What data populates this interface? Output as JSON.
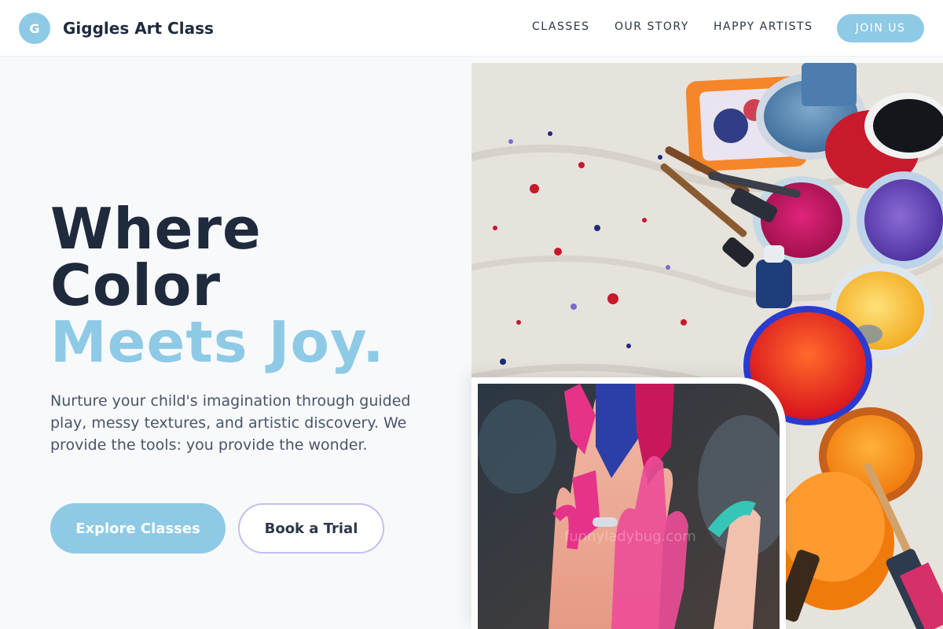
{
  "brand": {
    "logo_letter": "G",
    "name": "Giggles Art Class"
  },
  "nav": {
    "items": [
      {
        "label": "CLASSES"
      },
      {
        "label": "OUR STORY"
      },
      {
        "label": "HAPPY ARTISTS"
      }
    ],
    "cta_label": "JOIN US"
  },
  "hero": {
    "title_line1": "Where",
    "title_line2": "Color",
    "title_line3": "Meets Joy.",
    "description": "Nurture your child's imagination through guided play, messy textures, and artistic discovery. We provide the tools: you provide the wonder.",
    "primary_button": "Explore Classes",
    "secondary_button": "Book a Trial"
  },
  "images": {
    "main_photo": "paint-palettes-photo",
    "inset_photo": "painted-hands-photo",
    "inset_watermark": "funnyladybug.com"
  },
  "colors": {
    "accent": "#8ecae6",
    "text_dark": "#1f2a3d",
    "text_muted": "#4a5568",
    "secondary_border": "#c6bdf0",
    "background": "#f7f9fb"
  }
}
